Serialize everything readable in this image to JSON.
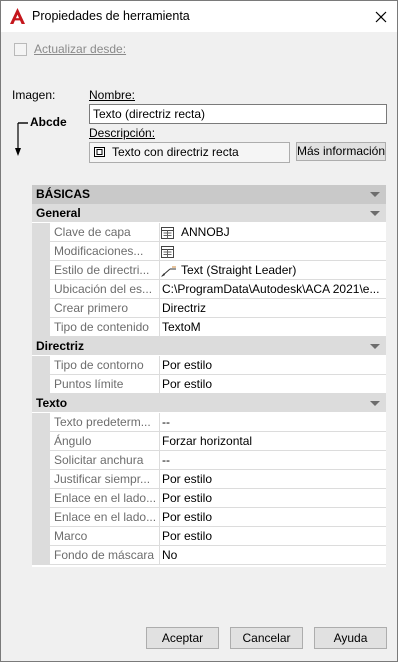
{
  "window": {
    "title": "Propiedades de herramienta",
    "accent": "#c4161c"
  },
  "update_from": {
    "label": "Actualizar desde:",
    "checked": false
  },
  "image": {
    "label": "Imagen:",
    "preview_text": "Abcde"
  },
  "name": {
    "label": "Nombre:",
    "value": "Texto (directriz recta)"
  },
  "description": {
    "label": "Descripción:",
    "value": "Texto con directriz recta"
  },
  "more_info_button": "Más información",
  "property_grid": {
    "top_category": "BÁSICAS",
    "categories": [
      {
        "title": "General",
        "rows": [
          {
            "name": "Clave de capa",
            "value": "ANNOBJ",
            "icon": "layer-key-icon"
          },
          {
            "name": "Modificaciones...",
            "value": "",
            "icon": "layer-key-icon"
          },
          {
            "name": "Estilo de directri...",
            "value": "Text (Straight Leader)",
            "icon": "leader-style-icon"
          },
          {
            "name": "Ubicación del es...",
            "value": "C:\\ProgramData\\Autodesk\\ACA  2021\\e...",
            "icon": ""
          },
          {
            "name": "Crear primero",
            "value": "Directriz",
            "icon": ""
          },
          {
            "name": "Tipo de contenido",
            "value": "TextoM",
            "icon": ""
          }
        ]
      },
      {
        "title": "Directriz",
        "rows": [
          {
            "name": "Tipo de contorno",
            "value": "Por estilo",
            "icon": ""
          },
          {
            "name": "Puntos límite",
            "value": "Por estilo",
            "icon": ""
          }
        ]
      },
      {
        "title": "Texto",
        "rows": [
          {
            "name": "Texto  predeterm...",
            "value": "--",
            "icon": ""
          },
          {
            "name": "Ángulo",
            "value": "Forzar horizontal",
            "icon": ""
          },
          {
            "name": "Solicitar anchura",
            "value": "--",
            "icon": ""
          },
          {
            "name": "Justificar  siempr...",
            "value": "Por estilo",
            "icon": ""
          },
          {
            "name": "Enlace en el lado...",
            "value": "Por estilo",
            "icon": ""
          },
          {
            "name": "Enlace en el lado...",
            "value": "Por estilo",
            "icon": ""
          },
          {
            "name": "Marco",
            "value": "Por estilo",
            "icon": ""
          },
          {
            "name": "Fondo de máscara",
            "value": "No",
            "icon": ""
          }
        ]
      }
    ]
  },
  "buttons": {
    "ok": "Aceptar",
    "cancel": "Cancelar",
    "help": "Ayuda"
  }
}
